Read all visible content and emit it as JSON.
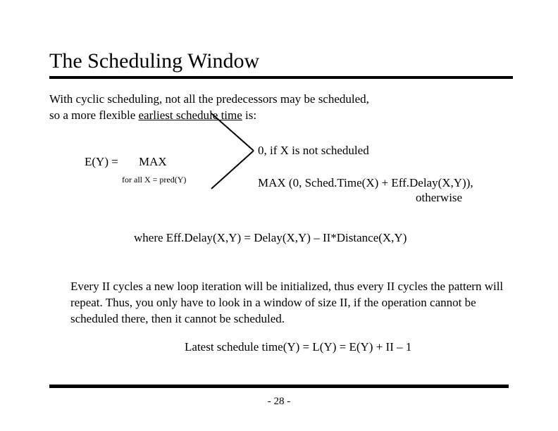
{
  "title": "The Scheduling Window",
  "intro_line1": "With cyclic scheduling, not all the predecessors may be scheduled,",
  "intro_line2_a": "so a more flexible ",
  "intro_line2_b": "earliest schedule time",
  "intro_line2_c": " is:",
  "formula": {
    "ey": "E(Y) = ",
    "max": "MAX",
    "forall": "for all X = pred(Y)",
    "case1": "0, if X is not scheduled",
    "case2a": "MAX (0, Sched.Time(X) + Eff.Delay(X,Y)),",
    "case2b": "otherwise"
  },
  "where": "where Eff.Delay(X,Y) = Delay(X,Y) – II*Distance(X,Y)",
  "para2": "Every II cycles a new loop iteration will be initialized, thus every II cycles the pattern will repeat.  Thus, you only have to look in a window of size II, if the operation cannot be scheduled there, then it cannot be scheduled.",
  "latest": "Latest schedule time(Y) = L(Y) = E(Y) + II – 1",
  "pagenum": "- 28 -"
}
